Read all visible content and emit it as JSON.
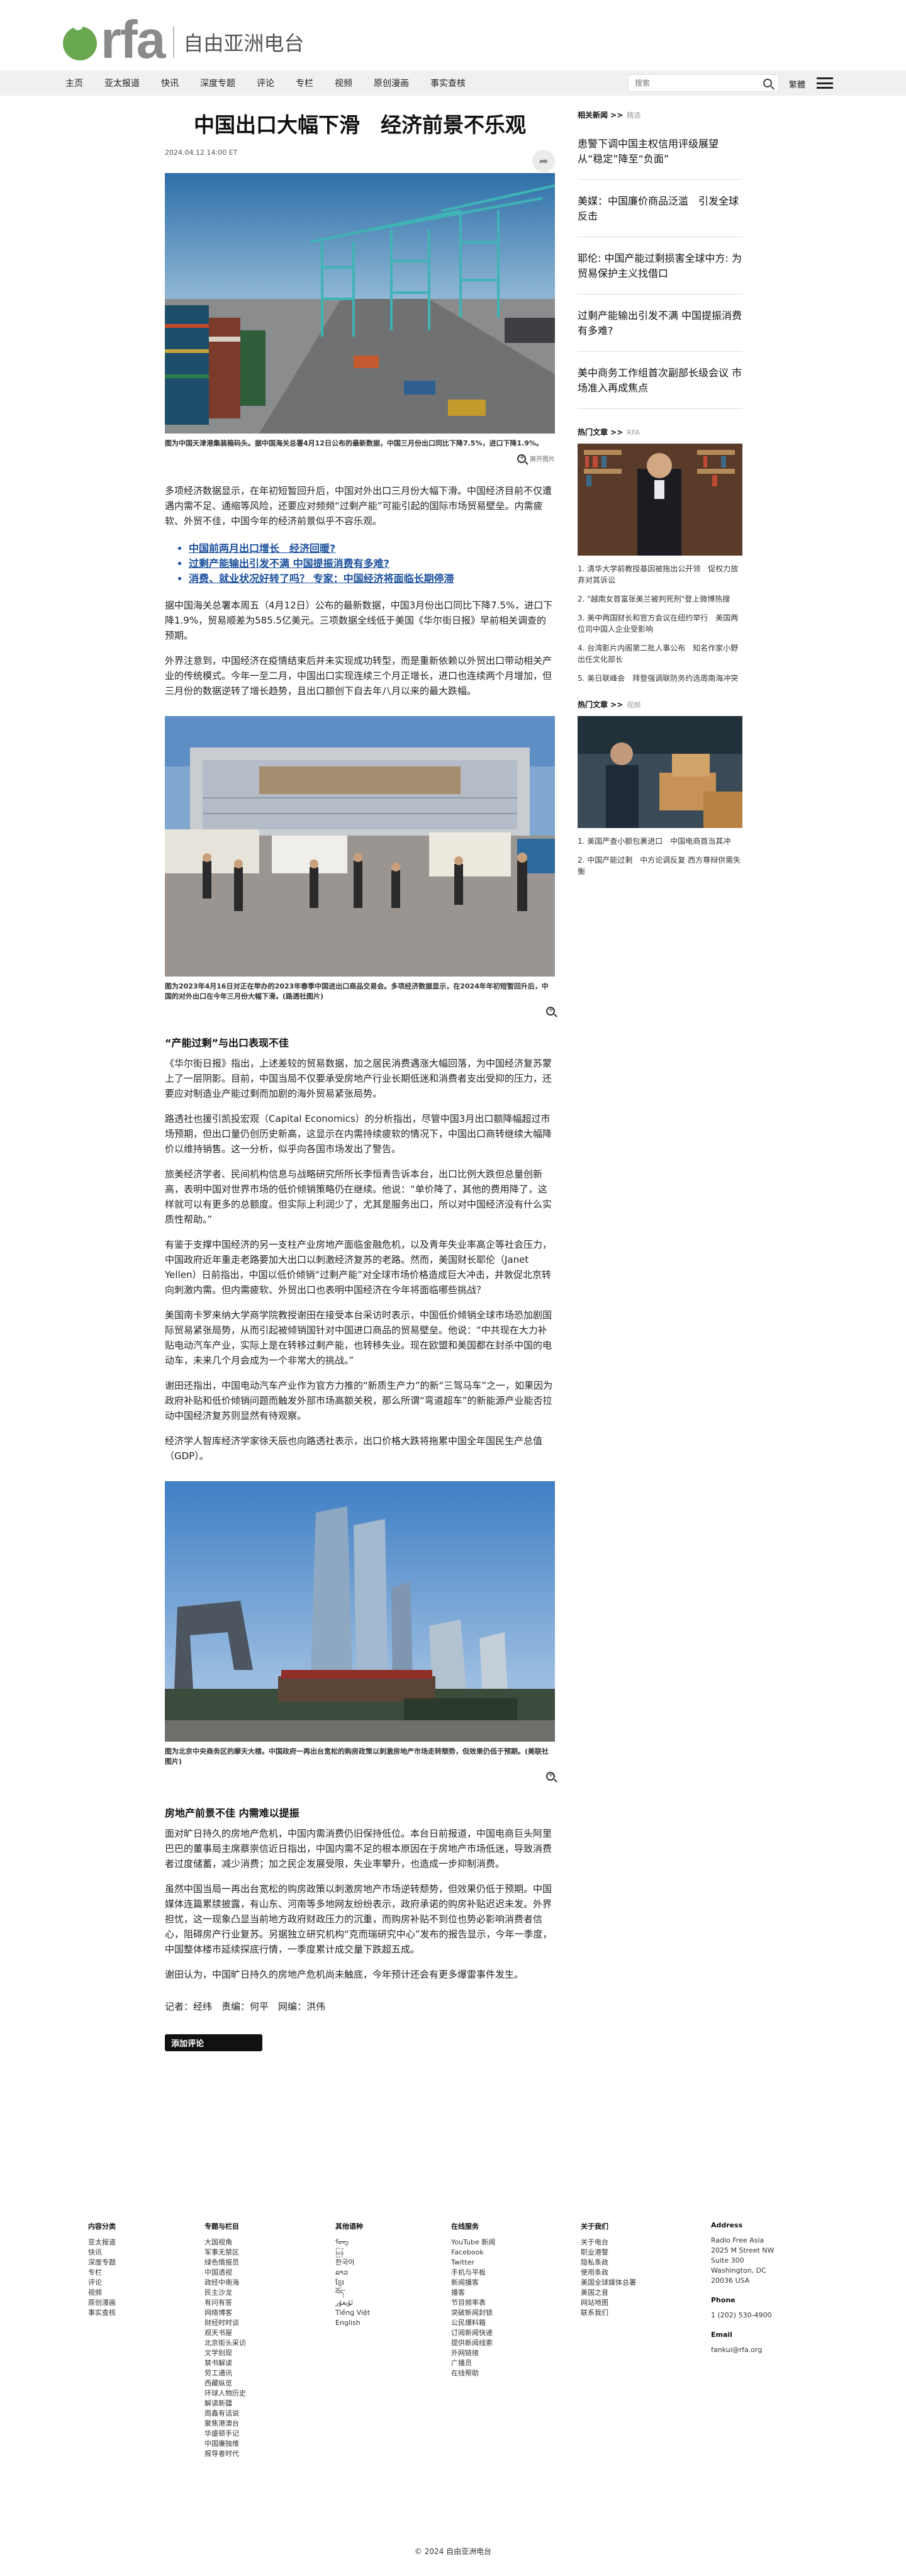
{
  "brand": {
    "logo_text": "rfa",
    "name": "自由亚洲电台"
  },
  "nav": {
    "items": [
      "主页",
      "亚太报道",
      "快讯",
      "深度专题",
      "评论",
      "专栏",
      "视频",
      "原创漫画",
      "事实查核"
    ],
    "search_placeholder": "搜索",
    "lang": "繁體"
  },
  "article": {
    "title": "中国出口大幅下滑　经济前景不乐观",
    "date": "2024.04.12 14:00 ET",
    "photo1_caption": "图为中国天津港集装箱码头。据中国海关总署4月12日公布的最新数据，中国三月份出口同比下降7.5%，进口下降1.9%。",
    "zoom_label": "展开图片",
    "p1": "多项经济数据显示，在年初短暂回升后，中国对外出口三月份大幅下滑。中国经济目前不仅遭遇内需不足、通缩等风险，还要应对频频“过剩产能”可能引起的国际市场贸易壁垒。内需疲软、外贸不佳，中国今年的经济前景似乎不容乐观。",
    "bullets": [
      "中国前两月出口增长　经济回暖?",
      "过剩产能输出引发不满 中国提振消费有多难?",
      "消费、就业状况好转了吗？ 专家：中国经济将面临长期停滞"
    ],
    "p2": "据中国海关总署本周五（4月12日）公布的最新数据，中国3月份出口同比下降7.5%，进口下降1.9%，贸易顺差为585.5亿美元。三项数据全线低于美国《华尔街日报》早前相关调查的预期。",
    "p3": "外界注意到，中国经济在疫情结束后并未实现成功转型，而是重新依赖以外贸出口带动相关产业的传统模式。今年一至二月，中国出口实现连续三个月正增长，进口也连续两个月增加，但三月份的数据逆转了增长趋势，且出口额创下自去年八月以来的最大跌幅。",
    "photo2_caption": "图为2023年4月16日对正在举办的2023年春季中国进出口商品交易会。多项经济数据显示，在2024年年初短暂回升后，中国的对外出口在今年三月份大幅下滑。(路透社图片)",
    "sub1": "“产能过剩”与出口表现不佳",
    "p4": "《华尔街日报》指出，上述差较的贸易数据，加之居民消费遇涨大幅回落，为中国经济复苏蒙上了一层阴影。目前，中国当局不仅要承受房地产行业长期低迷和消费者支出受抑的压力，还要应对制造业产能过剩而加剧的海外贸易紧张局势。",
    "p5": "路透社也援引凯投宏观（Capital Economics）的分析指出，尽管中国3月出口额降幅超过市场预期，但出口量仍创历史新高，这显示在内需持续疲软的情况下，中国出口商转继续大幅降价以维持销售。这一分析，似乎向各国市场发出了警告。",
    "p6": "旅美经济学者、民间机构信息与战略研究所所长李恒青告诉本台，出口比例大跌但总量创新高，表明中国对世界市场的低价倾销策略仍在继续。他说：“单价降了，其他的费用降了，这样就可以有更多的总额度。但实际上利润少了，尤其是服务出口，所以对中国经济没有什么实质性帮助。”",
    "p7": "有鉴于支撑中国经济的另一支柱产业房地产面临金融危机，以及青年失业率高企等社会压力，中国政府近年重走老路要加大出口以刺激经济复苏的老路。然而，美国财长耶伦（Janet Yellen）日前指出，中国以低价倾销“过剩产能”对全球市场价格造成巨大冲击，并敦促北京转向刺激内需。但内需疲软、外贸出口也表明中国经济在今年将面临哪些挑战？",
    "p8": "美国南卡罗来纳大学商学院教授谢田在接受本台采访时表示，中国低价倾销全球市场恐加剧国际贸易紧张局势，从而引起被倾销国针对中国进口商品的贸易壁垒。他说：“中共现在大力补贴电动汽车产业，实际上是在转移过剩产能，也转移失业。现在欧盟和美国都在封杀中国的电动车，未来几个月会成为一个非常大的挑战。”",
    "p9": "谢田还指出，中国电动汽车产业作为官方力推的“新质生产力”的新“三驾马车”之一，如果因为政府补贴和低价倾销问题而触发外部市场高额关税，那么所谓“弯道超车”的新能源产业能否拉动中国经济复苏则显然有待观察。",
    "p10": "经济学人智库经济学家徐天辰也向路透社表示，出口价格大跌将拖累中国全年国民生产总值（GDP）。",
    "photo3_caption": "图为北京中央商务区的摩天大楼。中国政府一再出台宽松的购房政策以刺激房地产市场走转颓势，但效果仍低于预期。(美联社图片)",
    "sub2": "房地产前景不佳 内需难以提振",
    "p11": "面对旷日持久的房地产危机，中国内需消费仍旧保持低位。本台日前报道，中国电商巨头阿里巴巴的董事局主席蔡崇信近日指出，中国内需不足的根本原因在于房地产市场低迷，导致消费者过度储蓄，减少消费；加之民企发展受限，失业率攀升，也造成一步抑制消费。",
    "p12": "虽然中国当局一再出台宽松的购房政策以刺激房地产市场逆转颓势，但效果仍低于预期。中国媒体连篇累牍披露，有山东、河南等多地网友纷纷表示，政府承诺的购房补贴迟迟未发。外界担忧，这一现象凸显当前地方政府财政压力的沉重，而购房补贴不到位也势必影响消费者信心，阻碍房产行业复苏。另据独立研究机构“克而瑞研究中心”发布的报告显示，今年一季度，中国整体楼市延续探底行情，一季度累计成交量下跌超五成。",
    "p13": "谢田认为，中国旷日持久的房地产危机尚未触底，今年预计还会有更多爆雷事件发生。",
    "byline": "记者：经纬　责编：何平　网编：洪伟",
    "comment_btn": "添加评论"
  },
  "sidebar": {
    "related_heading": "相关新闻 >>",
    "related_sub": "精选",
    "related": [
      "患警下调中国主权信用评级展望　从“稳定”降至“负面”",
      "美媒：中国廉价商品泛滥　引发全球反击",
      "耶伦: 中国产能过剩损害全球中方: 为贸易保护主义找借口",
      "过剩产能输出引发不满 中国提振消费有多难?",
      "美中商务工作组首次副部长级会议 市场准入再成焦点"
    ],
    "hot_heading": "热门文章 >>",
    "hot_sub": "RFA",
    "hot": [
      "1. 清华大学前教授基因被拖出公开领　促权力放弃对其诉讼",
      "2. \"越南女首富张美兰被判死刑\"登上微博热搜",
      "3. 美中两国财长和官方会议在纽约举行　美国两位司中国人企业受影响",
      "4. 台湾影片内阁第二批人事公布　知名作家小野出任文化部长",
      "5. 美日联峰会　拜登强调联防务约选周南海冲突"
    ],
    "hot2_heading": "热门文章 >>",
    "hot2_sub": "视频",
    "hot2": [
      "1. 美国严查小额包裹进口　中国电商首当其冲",
      "2. 中国产能过剩　中方论调反复 西方尊辩供需失衡"
    ]
  },
  "footer": {
    "cols": [
      {
        "heading": "内容分类",
        "links": [
          "亚太报道",
          "快讯",
          "深度专题",
          "专栏",
          "评论",
          "视频",
          "原创漫画",
          "事实查核"
        ]
      },
      {
        "heading": "专题与栏目",
        "links": [
          "大国视角",
          "军事无禁区",
          "绿色情报员",
          "中国透视",
          "政经中南海",
          "民主沙龙",
          "有问有答",
          "网络博客",
          "财经时时谈",
          "观天书屋",
          "北京街头采访",
          "文学别现",
          "禁书解读",
          "劳工通讯",
          "西藏纵览",
          "环球人物历史",
          "解读新疆",
          "周鑫有话说",
          "聚焦港澳台",
          "华盛顿手记",
          "中国廉独维",
          "报导者时代"
        ]
      },
      {
        "heading": "其他语种",
        "links": [
          "ᠮᠣᠩ",
          "မြန်",
          "한국어",
          "ລາວ",
          "ខ្មែរ",
          "བོད་",
          "ئۇيغۇر",
          "Tiếng Việt",
          "English"
        ]
      },
      {
        "heading": "在线服务",
        "links": [
          "YouTube 新闻",
          "Facebook",
          "Twitter",
          "手机与平板",
          "新闻播客",
          "播客",
          "节目频率表",
          "突破新闻封锁",
          "公民爆料箱",
          "订阅新闻快递",
          "提供新闻线索",
          "外网链接",
          "广播员",
          "在线帮助"
        ]
      },
      {
        "heading": "关于我们",
        "links": [
          "关于电台",
          "职业港警",
          "隐私条政",
          "使用条政",
          "美国全球媒体总署",
          "美国之音",
          "网站地图",
          "联系我们"
        ]
      },
      {
        "heading": "Address",
        "links": [
          "Radio Free Asia",
          "2025 M Street NW",
          "Suite 300",
          "Washington, DC",
          "20036 USA"
        ],
        "heading2": "Phone",
        "links2": [
          "1 (202) 530-4900"
        ],
        "heading3": "Email",
        "links3": [
          "fankui@rfa.org"
        ]
      }
    ],
    "copyright": "© 2024 自由亚洲电台"
  }
}
